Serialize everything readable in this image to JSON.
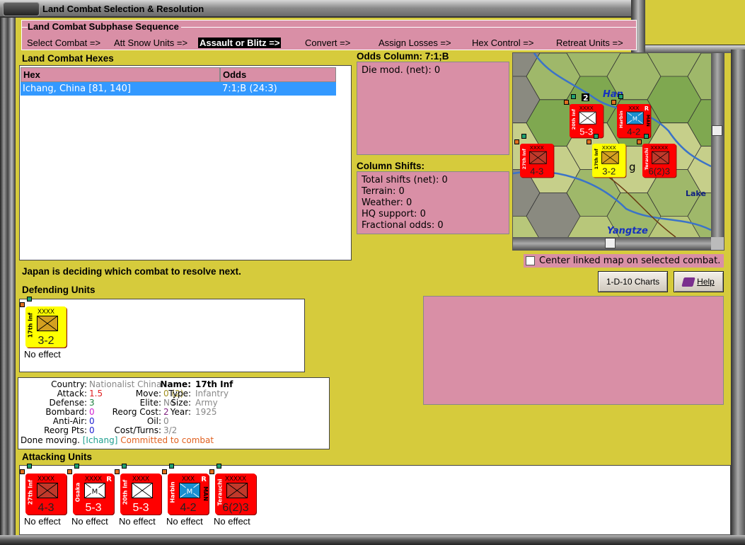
{
  "window": {
    "title": "Land Combat Selection & Resolution"
  },
  "subphase": {
    "legend": "Land Combat Subphase Sequence",
    "steps": [
      "Select Combat =>",
      "Att Snow Units =>",
      "Assault or Blitz =>",
      "Convert =>",
      "Assign Losses =>",
      "Hex Control =>",
      "Retreat Units =>"
    ],
    "active_index": 2
  },
  "hexes": {
    "label": "Land Combat Hexes",
    "columns": [
      "Hex",
      "Odds"
    ],
    "rows": [
      {
        "hex": "Ichang, China [81, 140]",
        "odds": "7:1;B (24:3)",
        "selected": true
      }
    ]
  },
  "odds": {
    "label": "Odds Column: 7:1;B",
    "die_mod": "Die mod. (net): 0"
  },
  "shifts": {
    "label": "Column Shifts:",
    "lines": [
      "Total shifts (net): 0",
      "Terrain: 0",
      "Weather: 0",
      "HQ support: 0",
      "Fractional odds: 0"
    ]
  },
  "map": {
    "labels": {
      "river1": "Han",
      "river2": "Yangtze",
      "lake": "Lake",
      "city_fragment": "g"
    },
    "stack_count": "2"
  },
  "center_checkbox": {
    "label": "Center linked map on selected combat.",
    "checked": false
  },
  "buttons": {
    "charts": "1-D-10 Charts",
    "help": "Help",
    "help_icon": "book-icon"
  },
  "status": "Japan is deciding which combat to resolve next.",
  "defending": {
    "label": "Defending Units",
    "units": [
      {
        "name": "17th Inf",
        "size": "XXXX",
        "strength": "3-2",
        "color": "#ffff00",
        "symbol_color": "#d4a020",
        "symbol": "infantry",
        "result": "No effect"
      }
    ]
  },
  "info": {
    "country_label": "Country:",
    "country": "Nationalist China",
    "attack_label": "Attack:",
    "attack": "1.5",
    "defense_label": "Defense:",
    "defense": "3",
    "bombard_label": "Bombard:",
    "bombard": "0",
    "antiair_label": "Anti-Air:",
    "antiair": "0",
    "reorgpts_label": "Reorg Pts:",
    "reorgpts": "0",
    "move_label": "Move:",
    "move": "0 (2)",
    "elite_label": "Elite:",
    "elite": "No",
    "reorgcost_label": "Reorg Cost:",
    "reorgcost": "2",
    "oil_label": "Oil:",
    "oil": "0",
    "costturns_label": "Cost/Turns:",
    "costturns": "3/2",
    "name_label": "Name:",
    "name": "17th Inf",
    "type_label": "Type:",
    "type": "Infantry",
    "size_label": "Size:",
    "size": "Army",
    "year_label": "Year:",
    "year": "1925",
    "status": "Done moving.",
    "location": "[Ichang]",
    "combat": "Committed to combat"
  },
  "attacking": {
    "label": "Attacking Units",
    "units": [
      {
        "name": "27th Inf",
        "size": "XXXX",
        "strength": "4-3",
        "color": "#ff0000",
        "symbol_color": "#c0392b",
        "symbol": "infantry",
        "result": "No effect"
      },
      {
        "name": "Osaka",
        "size": "XXXX",
        "strength": "5-3",
        "color": "#ff0000",
        "symbol_color": "#ffffff",
        "symbol": "mech",
        "mark": "R",
        "result": "No effect"
      },
      {
        "name": "20th Inf",
        "size": "XXXX",
        "strength": "5-3",
        "color": "#ff0000",
        "symbol_color": "#ffffff",
        "symbol": "infantry",
        "result": "No effect"
      },
      {
        "name": "Harbin",
        "size": "XXX",
        "strength": "4-2",
        "color": "#ff0000",
        "symbol_color": "#1a8fd0",
        "symbol": "mech",
        "mark": "R",
        "side": "MAN",
        "result": "No effect"
      },
      {
        "name": "Terauchi",
        "size": "XXXXX",
        "strength": "6(2)3",
        "color": "#ff0000",
        "symbol_color": "#c0392b",
        "symbol": "infantry",
        "result": "No effect"
      }
    ]
  },
  "colors": {
    "background": "#d6cb3c",
    "panel_pink": "#d98fa6",
    "selection": "#3399ff",
    "attack": "#e02020",
    "defense": "#208040",
    "bombard": "#d020d0",
    "antiair": "#2020d0",
    "move": "#a09020",
    "location": "#20a090",
    "committed": "#e06020"
  }
}
